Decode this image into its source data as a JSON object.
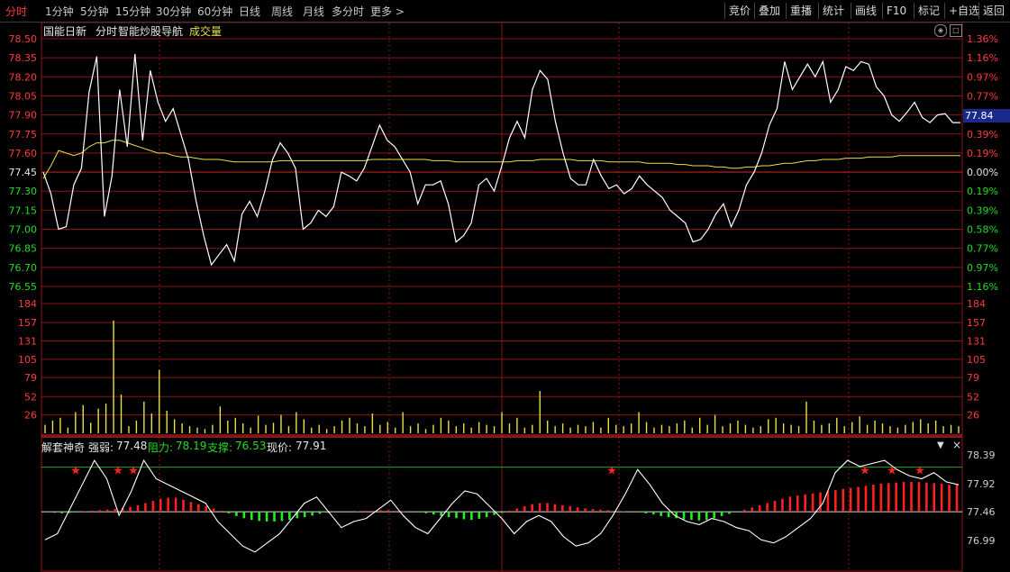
{
  "toolbar": {
    "timeframes": [
      "分时",
      "1分钟",
      "5分钟",
      "15分钟",
      "30分钟",
      "60分钟",
      "日线",
      "周线",
      "月线",
      "多分时",
      "更多 >"
    ],
    "active_timeframe": "分时",
    "right_buttons": [
      "竞价",
      "叠加",
      "重播",
      "统计",
      "画线",
      "F10",
      "标记",
      "+自选",
      "返回"
    ]
  },
  "price_panel": {
    "stock_name": "国能日新",
    "mode_label": "分时",
    "app_label": "智能炒股导航",
    "volume_label": "成交量",
    "current_price_tag": "77.84",
    "colors": {
      "price_line": "#ffffff",
      "avg_line": "#e8e04a",
      "up": "#ff3b3b",
      "down": "#22dd22",
      "grid": "#8c1414"
    }
  },
  "indicator_panel": {
    "name": "解套神奇",
    "strength_label": "强弱:",
    "strength_value": "77.48",
    "resistance_label": "阻力:",
    "resistance_value": "78.19",
    "support_label": "支撑:",
    "support_value": "76.53",
    "current_label": "现价:",
    "current_value": "77.91",
    "right_ticks": [
      "78.39",
      "77.92",
      "77.46",
      "76.99"
    ]
  },
  "chart_data": [
    {
      "type": "line",
      "name": "price",
      "yticks_left": [
        "78.50",
        "78.35",
        "78.20",
        "78.05",
        "77.90",
        "77.75",
        "77.60",
        "77.45",
        "77.30",
        "77.15",
        "77.00",
        "76.85",
        "76.70",
        "76.55"
      ],
      "yticks_right": [
        "1.36%",
        "1.16%",
        "0.97%",
        "0.77%",
        "0.58%",
        "0.39%",
        "0.19%",
        "0.00%",
        "0.19%",
        "0.39%",
        "0.58%",
        "0.77%",
        "0.97%",
        "1.16%"
      ],
      "ylim": [
        76.55,
        78.5
      ],
      "reference": 77.45,
      "x": [
        0,
        2,
        4,
        6,
        8,
        10,
        12,
        14,
        16,
        18,
        20,
        22,
        24,
        26,
        28,
        30,
        32,
        34,
        36,
        38,
        40,
        42,
        44,
        46,
        48,
        50,
        52,
        54,
        56,
        58,
        60,
        62,
        64,
        66,
        68,
        70,
        72,
        74,
        76,
        78,
        80,
        82,
        84,
        86,
        88,
        90,
        92,
        94,
        96,
        98,
        100,
        102,
        104,
        106,
        108,
        110,
        112,
        114,
        116,
        118,
        120,
        122,
        124,
        126,
        128,
        130,
        132,
        134,
        136,
        138,
        140,
        142,
        144,
        146,
        148,
        150,
        152,
        154,
        156,
        158,
        160,
        162,
        164,
        166,
        168,
        170,
        172,
        174,
        176,
        178,
        180,
        182,
        184,
        186,
        188,
        190,
        192,
        194,
        196,
        198,
        200,
        202,
        204,
        206,
        208,
        210,
        212,
        214,
        216,
        218,
        220,
        222,
        224,
        226,
        228,
        230,
        232,
        234,
        236,
        238,
        240
      ],
      "series": [
        {
          "name": "",
          "values": [
            77.45,
            77.28,
            77.0,
            77.02,
            77.35,
            77.48,
            78.08,
            78.36,
            77.1,
            77.42,
            78.1,
            77.65,
            78.38,
            77.7,
            78.25,
            78.0,
            77.85,
            77.95,
            77.75,
            77.55,
            77.22,
            76.95,
            76.72,
            76.8,
            76.88,
            76.75,
            77.12,
            77.22,
            77.1,
            77.3,
            77.55,
            77.68,
            77.6,
            77.48,
            77.0,
            77.05,
            77.15,
            77.1,
            77.18,
            77.45,
            77.42,
            77.38,
            77.48,
            77.65,
            77.82,
            77.7,
            77.65,
            77.55,
            77.45,
            77.2,
            77.35,
            77.35,
            77.38,
            77.2,
            76.9,
            76.95,
            77.05,
            77.35,
            77.4,
            77.3,
            77.5,
            77.72,
            77.85,
            77.72,
            78.1,
            78.25,
            78.18,
            77.85,
            77.6,
            77.4,
            77.35,
            77.35,
            77.55,
            77.42,
            77.32,
            77.35,
            77.28,
            77.32,
            77.42,
            77.35,
            77.3,
            77.25,
            77.15,
            77.1,
            77.05,
            76.9,
            76.92,
            77.0,
            77.12,
            77.2,
            77.02,
            77.15,
            77.35,
            77.45,
            77.6,
            77.82,
            77.95,
            78.32,
            78.1,
            78.2,
            78.3,
            78.2,
            78.32,
            78.0,
            78.1,
            78.28,
            78.25,
            78.32,
            78.3,
            78.12,
            78.05,
            77.9,
            77.85,
            77.92,
            78.0,
            77.88,
            77.84,
            77.9,
            77.91,
            77.84,
            77.84
          ]
        },
        {
          "name": "",
          "values": [
            77.4,
            77.5,
            77.62,
            77.6,
            77.58,
            77.6,
            77.65,
            77.68,
            77.68,
            77.7,
            77.7,
            77.68,
            77.66,
            77.64,
            77.62,
            77.6,
            77.6,
            77.58,
            77.57,
            77.57,
            77.56,
            77.55,
            77.55,
            77.55,
            77.54,
            77.53,
            77.53,
            77.53,
            77.53,
            77.53,
            77.53,
            77.54,
            77.54,
            77.54,
            77.54,
            77.54,
            77.54,
            77.54,
            77.54,
            77.54,
            77.54,
            77.54,
            77.54,
            77.55,
            77.55,
            77.55,
            77.55,
            77.55,
            77.55,
            77.55,
            77.55,
            77.54,
            77.54,
            77.54,
            77.53,
            77.53,
            77.53,
            77.53,
            77.53,
            77.53,
            77.53,
            77.53,
            77.54,
            77.54,
            77.54,
            77.55,
            77.55,
            77.55,
            77.55,
            77.55,
            77.54,
            77.54,
            77.54,
            77.54,
            77.53,
            77.53,
            77.53,
            77.53,
            77.53,
            77.52,
            77.52,
            77.52,
            77.52,
            77.51,
            77.51,
            77.5,
            77.5,
            77.5,
            77.49,
            77.49,
            77.48,
            77.48,
            77.49,
            77.49,
            77.5,
            77.5,
            77.51,
            77.52,
            77.52,
            77.53,
            77.54,
            77.54,
            77.55,
            77.55,
            77.55,
            77.56,
            77.56,
            77.56,
            77.57,
            77.57,
            77.57,
            77.57,
            77.58,
            77.58,
            77.58,
            77.58,
            77.58,
            77.58,
            77.58,
            77.58,
            77.58
          ]
        }
      ]
    },
    {
      "type": "bar",
      "name": "volume",
      "yticks": [
        "184",
        "157",
        "131",
        "105",
        "79",
        "52",
        "26"
      ],
      "ylim": [
        0,
        184
      ],
      "values": [
        12,
        18,
        22,
        8,
        30,
        40,
        15,
        35,
        42,
        160,
        55,
        10,
        18,
        45,
        28,
        90,
        32,
        20,
        14,
        10,
        8,
        6,
        12,
        38,
        18,
        22,
        14,
        8,
        25,
        12,
        15,
        26,
        10,
        30,
        20,
        8,
        12,
        6,
        10,
        18,
        22,
        14,
        10,
        28,
        12,
        16,
        8,
        30,
        10,
        14,
        6,
        12,
        22,
        18,
        10,
        14,
        8,
        16,
        12,
        10,
        30,
        14,
        22,
        8,
        12,
        60,
        18,
        10,
        14,
        8,
        12,
        10,
        16,
        8,
        22,
        12,
        10,
        14,
        30,
        16,
        8,
        12,
        10,
        14,
        18,
        8,
        22,
        12,
        26,
        10,
        14,
        18,
        12,
        8,
        10,
        20,
        22,
        14,
        12,
        10,
        45,
        18,
        12,
        14,
        22,
        10,
        16,
        24,
        12,
        18,
        14,
        10,
        8,
        12,
        16,
        20,
        14,
        18,
        10,
        12,
        10
      ]
    },
    {
      "type": "bar",
      "name": "indicator",
      "ylim": [
        76.99,
        78.39
      ],
      "bars": [
        0.0,
        -0.02,
        -0.03,
        -0.02,
        -0.01,
        0.01,
        0.02,
        0.03,
        0.04,
        0.05,
        0.07,
        0.09,
        0.12,
        0.16,
        0.2,
        0.24,
        0.26,
        0.26,
        0.22,
        0.18,
        0.14,
        0.1,
        0.06,
        0.02,
        -0.03,
        -0.08,
        -0.12,
        -0.15,
        -0.17,
        -0.18,
        -0.18,
        -0.17,
        -0.15,
        -0.12,
        -0.1,
        -0.07,
        -0.04,
        -0.02,
        -0.01,
        -0.0,
        0.0,
        0.01,
        0.02,
        0.02,
        0.03,
        0.03,
        0.02,
        0.01,
        0.0,
        -0.01,
        -0.03,
        -0.05,
        -0.08,
        -0.1,
        -0.12,
        -0.14,
        -0.15,
        -0.13,
        -0.1,
        -0.06,
        -0.02,
        0.02,
        0.06,
        0.1,
        0.14,
        0.16,
        0.16,
        0.14,
        0.12,
        0.1,
        0.08,
        0.06,
        0.05,
        0.04,
        0.03,
        0.02,
        0.01,
        0.0,
        -0.01,
        -0.03,
        -0.05,
        -0.08,
        -0.1,
        -0.12,
        -0.14,
        -0.15,
        -0.16,
        -0.15,
        -0.12,
        -0.08,
        -0.04,
        0.0,
        0.04,
        0.08,
        0.12,
        0.16,
        0.2,
        0.24,
        0.28,
        0.3,
        0.32,
        0.34,
        0.36,
        0.38,
        0.4,
        0.42,
        0.44,
        0.46,
        0.48,
        0.5,
        0.52,
        0.53,
        0.54,
        0.55,
        0.55,
        0.55,
        0.54,
        0.53,
        0.52,
        0.5,
        0.5
      ],
      "line": [
        77.0,
        77.1,
        77.5,
        77.9,
        78.3,
        78.0,
        77.4,
        77.8,
        78.3,
        78.0,
        77.9,
        77.8,
        77.7,
        77.6,
        77.3,
        77.1,
        76.9,
        76.8,
        76.95,
        77.1,
        77.35,
        77.6,
        77.7,
        77.45,
        77.2,
        77.3,
        77.35,
        77.5,
        77.65,
        77.4,
        77.2,
        77.1,
        77.35,
        77.6,
        77.8,
        77.75,
        77.55,
        77.35,
        77.1,
        77.3,
        77.4,
        77.3,
        77.05,
        76.9,
        76.95,
        77.1,
        77.4,
        77.75,
        78.15,
        77.9,
        77.6,
        77.4,
        77.3,
        77.25,
        77.35,
        77.3,
        77.2,
        77.15,
        77.0,
        76.95,
        77.05,
        77.2,
        77.35,
        77.6,
        78.1,
        78.3,
        78.2,
        78.25,
        78.3,
        78.15,
        78.05,
        78.0,
        78.1,
        77.95,
        77.9
      ]
    }
  ]
}
